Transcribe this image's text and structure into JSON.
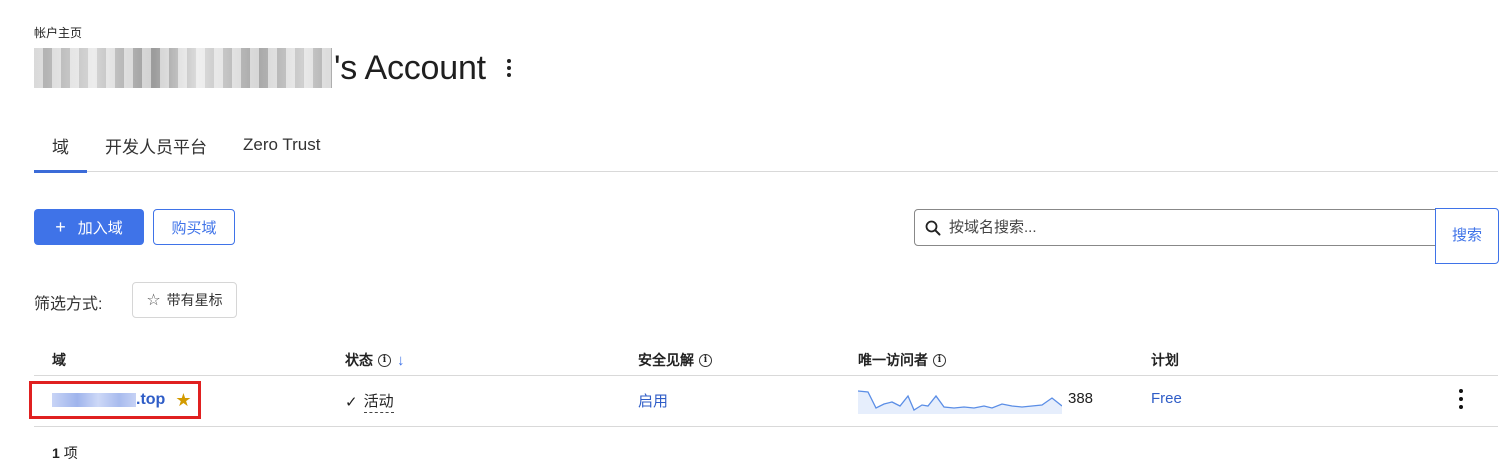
{
  "breadcrumb": "帐户主页",
  "account": {
    "title_suffix": "'s Account"
  },
  "tabs": [
    {
      "label": "域",
      "active": true
    },
    {
      "label": "开发人员平台",
      "active": false
    },
    {
      "label": "Zero Trust",
      "active": false
    }
  ],
  "actions": {
    "add_plus": "+",
    "add_label": "加入域",
    "buy_label": "购买域"
  },
  "search": {
    "placeholder": "按域名搜索...",
    "button_label": "搜索"
  },
  "filter": {
    "label": "筛选方式:",
    "chip_star": "☆",
    "chip_label": "带有星标"
  },
  "table": {
    "headers": {
      "domain": "域",
      "status": "状态",
      "security": "安全见解",
      "visitors": "唯一访问者",
      "plan": "计划"
    },
    "rows": [
      {
        "domain_suffix": ".top",
        "starred_icon": "★",
        "status_check": "✓",
        "status": "活动",
        "security": "启用",
        "visitors": "388",
        "plan": "Free"
      }
    ]
  },
  "footer": {
    "count_number": "1",
    "count_unit": "项"
  },
  "colors": {
    "accent": "#3f73e8",
    "link": "#2f5dc7",
    "star": "#d39b00",
    "highlight_box": "#e02020"
  },
  "icons": {
    "search": "search-icon",
    "kebab": "kebab-menu-icon",
    "info": "info-icon",
    "star": "star-icon",
    "check": "check-icon",
    "sort": "sort-down-icon"
  }
}
